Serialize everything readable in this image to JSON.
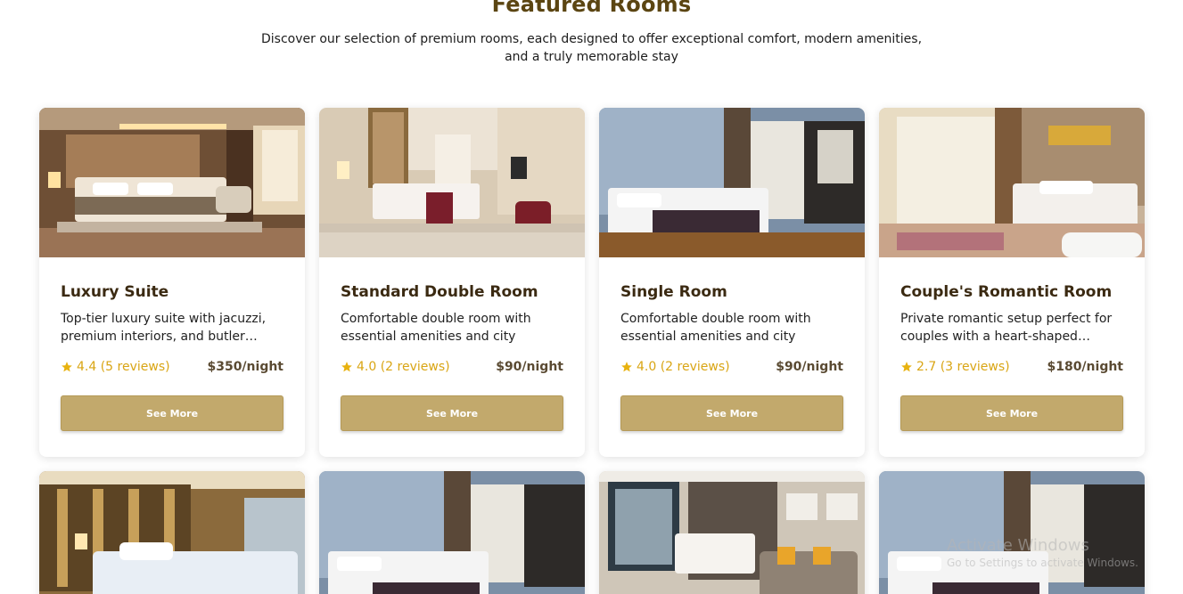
{
  "section": {
    "title": "Featured Rooms",
    "subtitle": "Discover our selection of premium rooms, each designed to offer exceptional comfort, modern amenities, and a truly memorable stay"
  },
  "theme": {
    "accent": "#c2a96c",
    "title_color": "#5b4512",
    "star_color": "#d9a514"
  },
  "rooms": [
    {
      "title": "Luxury Suite",
      "description": "Top-tier luxury suite with jacuzzi, premium interiors, and butler…",
      "rating": "4.4 (5 reviews)",
      "price": "$350/night",
      "button": "See More",
      "photo": "warm-suite"
    },
    {
      "title": "Standard Double Room",
      "description": "Comfortable double room with essential amenities and city view.…",
      "rating": "4.0 (2 reviews)",
      "price": "$90/night",
      "button": "See More",
      "photo": "beige-double"
    },
    {
      "title": "Single Room",
      "description": "Comfortable double room with essential amenities and city view.…",
      "rating": "4.0 (2 reviews)",
      "price": "$90/night",
      "button": "See More",
      "photo": "blue-wall"
    },
    {
      "title": "Couple's Romantic Room",
      "description": "Private romantic setup perfect for couples with a heart-shaped…",
      "rating": "2.7 (3 reviews)",
      "price": "$180/night",
      "button": "See More",
      "photo": "romantic"
    }
  ],
  "rooms_row2": [
    {
      "photo": "gold-curtains"
    },
    {
      "photo": "blue-wall"
    },
    {
      "photo": "sofa-room"
    },
    {
      "photo": "blue-wall"
    }
  ],
  "watermark": {
    "line1": "Activate Windows",
    "line2": "Go to Settings to activate Windows."
  }
}
